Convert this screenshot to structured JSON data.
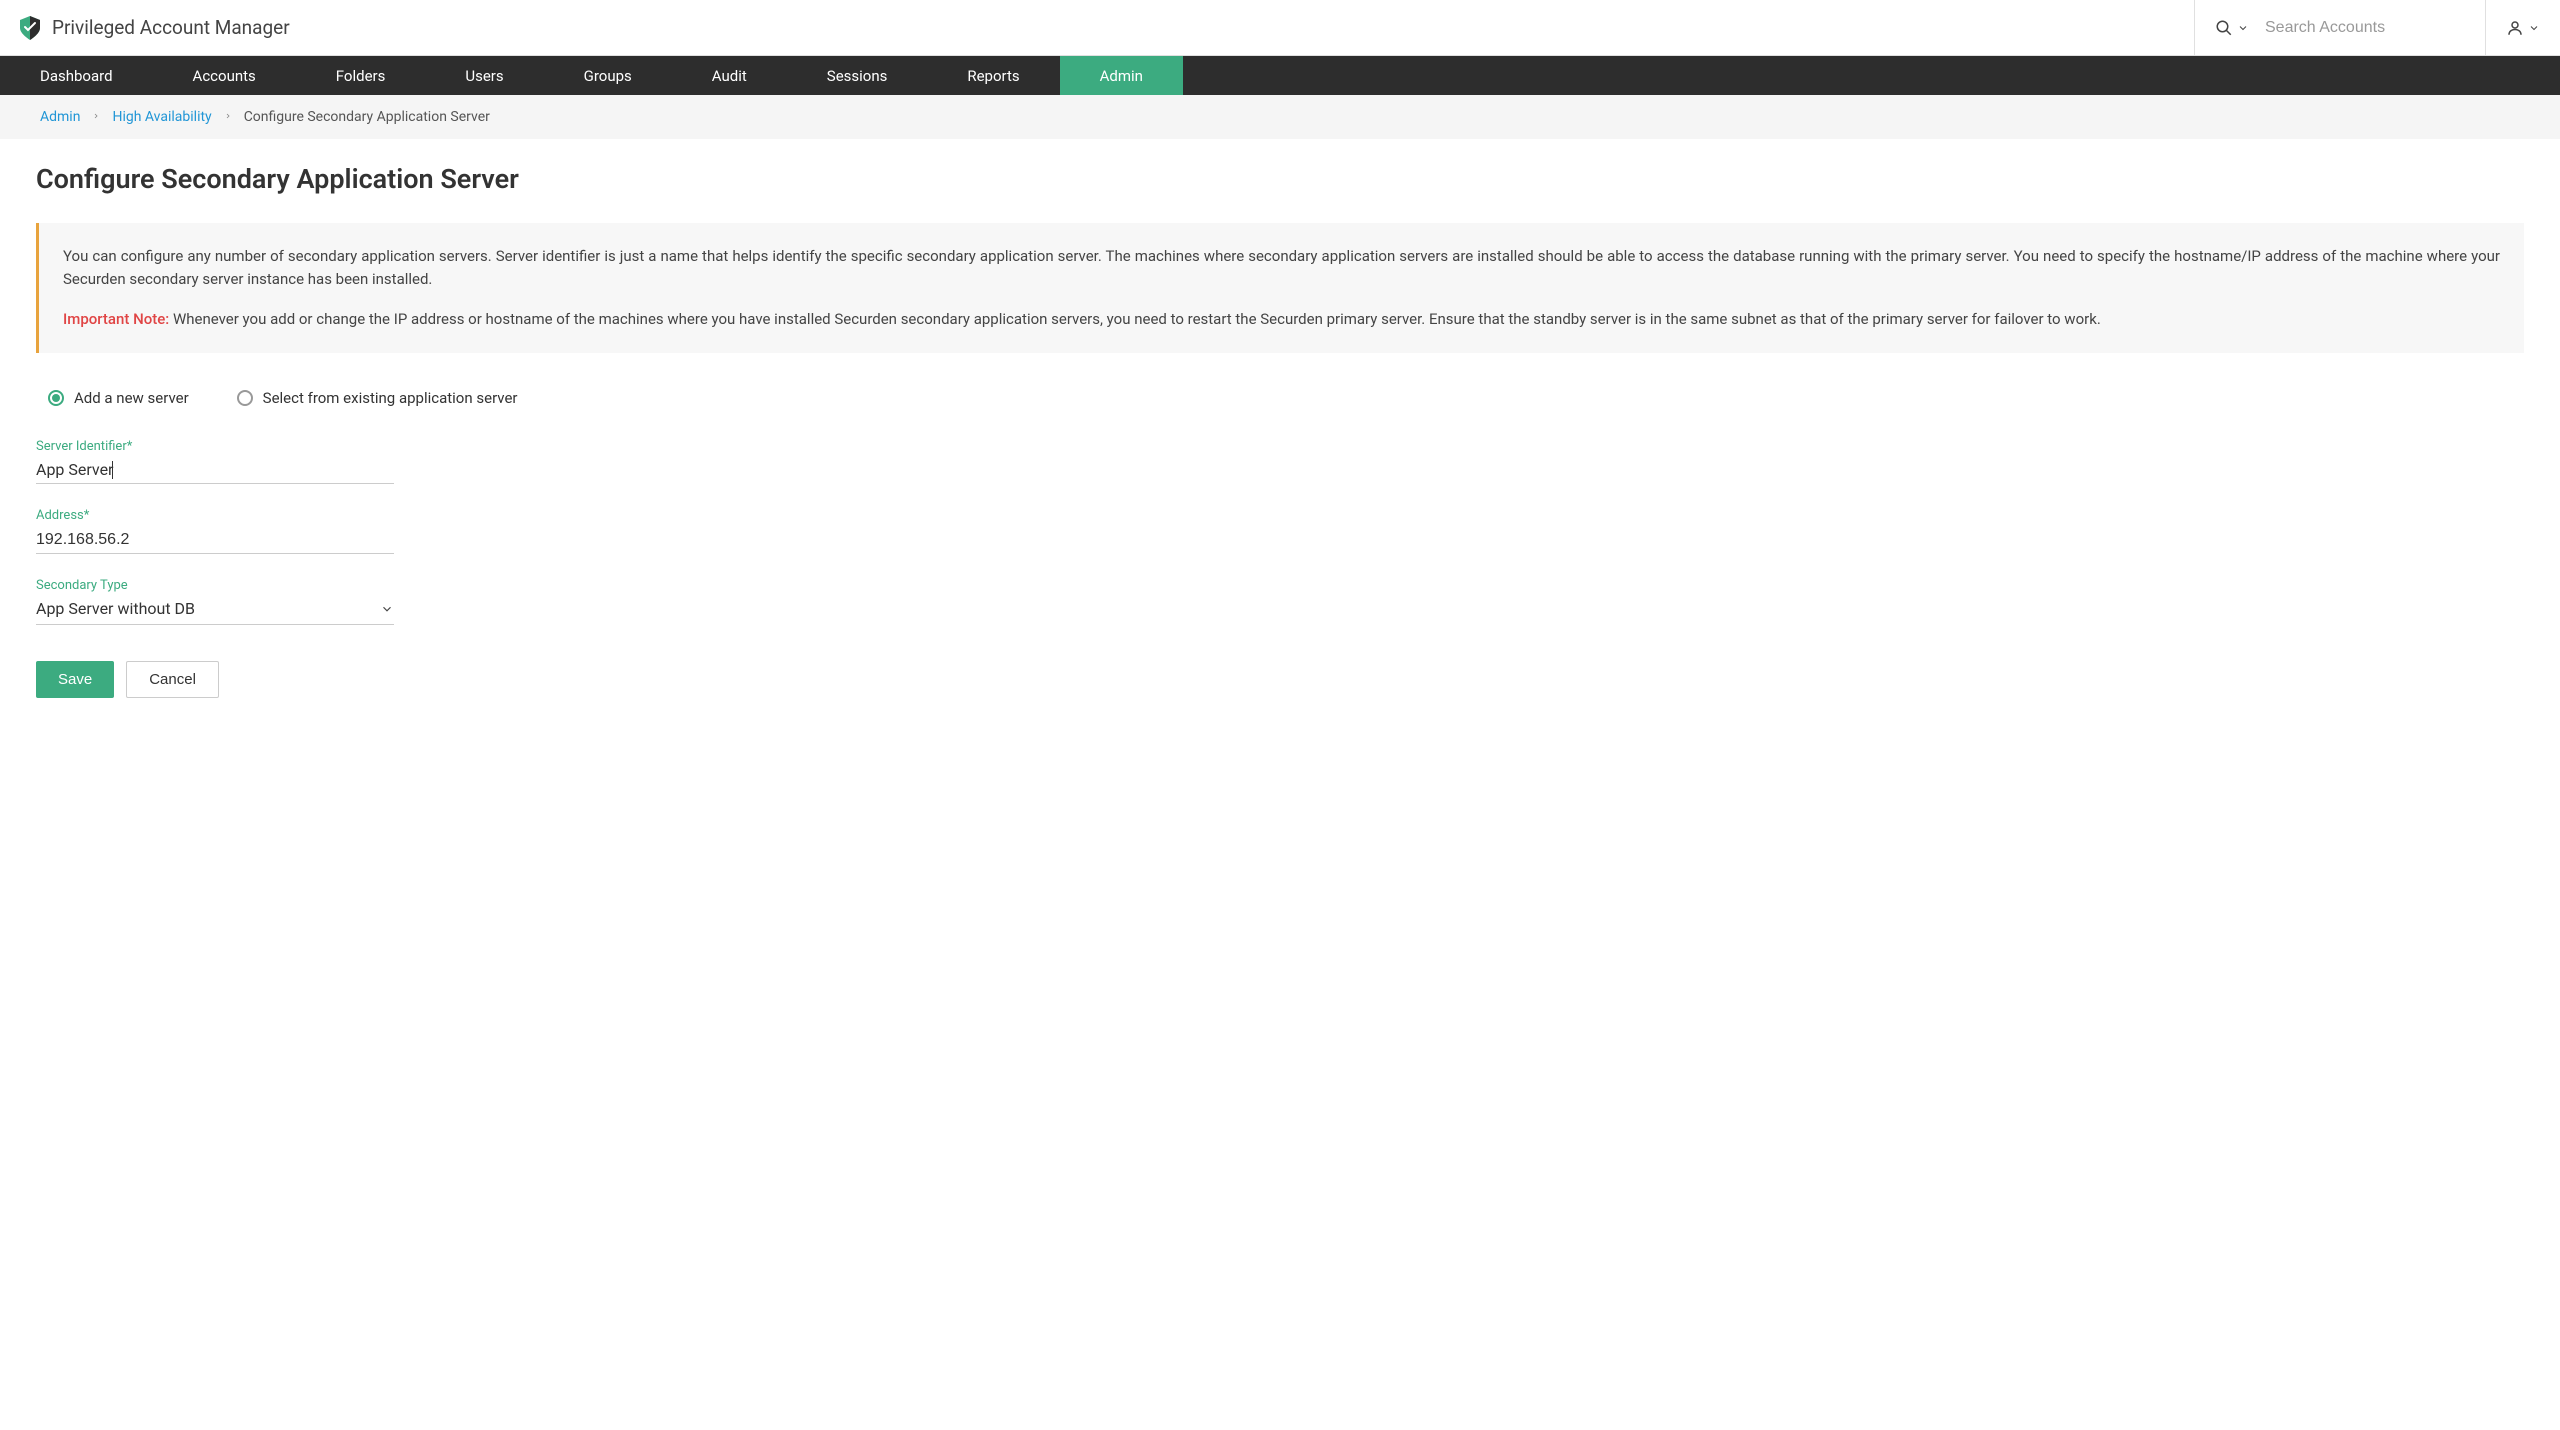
{
  "header": {
    "app_name": "Privileged Account Manager",
    "search_placeholder": "Search Accounts"
  },
  "nav": {
    "items": [
      "Dashboard",
      "Accounts",
      "Folders",
      "Users",
      "Groups",
      "Audit",
      "Sessions",
      "Reports",
      "Admin"
    ],
    "active": "Admin"
  },
  "breadcrumb": {
    "items": [
      {
        "label": "Admin",
        "link": true
      },
      {
        "label": "High Availability",
        "link": true
      },
      {
        "label": "Configure Secondary Application Server",
        "link": false
      }
    ]
  },
  "page": {
    "title": "Configure Secondary Application Server",
    "info_text1": "You can configure any number of secondary application servers. Server identifier is just a name that helps identify the specific secondary application server. The machines where secondary application servers are installed should be able to access the database running with the primary server. You need to specify the hostname/IP address of the machine where your Securden secondary server instance has been installed.",
    "important_label": "Important Note:",
    "info_text2": "Whenever you add or change the IP address or hostname of the machines where you have installed Securden secondary application servers, you need to restart the Securden primary server. Ensure that the standby server is in the same subnet as that of the primary server for failover to work."
  },
  "radio": {
    "option1": "Add a new server",
    "option2": "Select from existing application server",
    "selected": "option1"
  },
  "form": {
    "server_identifier": {
      "label": "Server Identifier*",
      "value": "App Server"
    },
    "address": {
      "label": "Address*",
      "value": "192.168.56.2"
    },
    "secondary_type": {
      "label": "Secondary Type",
      "value": "App Server without DB"
    }
  },
  "actions": {
    "save": "Save",
    "cancel": "Cancel"
  },
  "colors": {
    "accent": "#3cab80",
    "nav_bg": "#2d2d2d",
    "warning_border": "#e8a33d",
    "danger_text": "#e04545",
    "link": "#2196d6"
  }
}
